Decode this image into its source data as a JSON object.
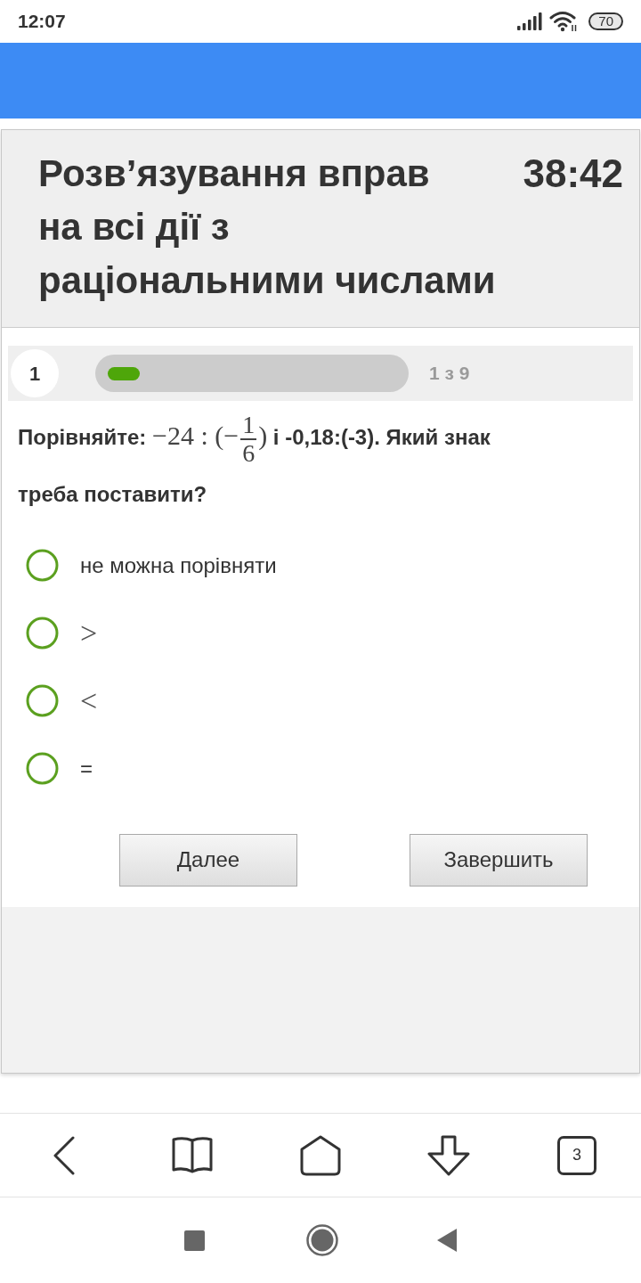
{
  "status_bar": {
    "time": "12:07",
    "battery": "70"
  },
  "quiz": {
    "title": "Розв’язування вправ на всі дії з раціональними числами",
    "timer": "38:42"
  },
  "progress": {
    "question_number": "1",
    "level": 0.11,
    "counter": "1 з 9"
  },
  "question": {
    "parts": [
      {
        "kind": "text",
        "text": "Порівняйте: "
      },
      {
        "kind": "math",
        "text": "−24 : (−"
      },
      {
        "kind": "fraction",
        "numerator": "1",
        "denominator": "6"
      },
      {
        "kind": "math",
        "text": ")"
      },
      {
        "kind": "text",
        "text": " і -0,18:(-3). Який знак треба поставити?"
      }
    ]
  },
  "options": [
    {
      "kind": "text",
      "text": "не можна порівняти",
      "selected": false
    },
    {
      "kind": "math",
      "text": ">",
      "selected": false
    },
    {
      "kind": "math",
      "text": "<",
      "selected": false
    },
    {
      "kind": "text",
      "text": "=",
      "selected": false
    }
  ],
  "buttons": [
    "Далее",
    "Завершить"
  ],
  "browser_toolbar": {
    "tab_count": "3"
  }
}
